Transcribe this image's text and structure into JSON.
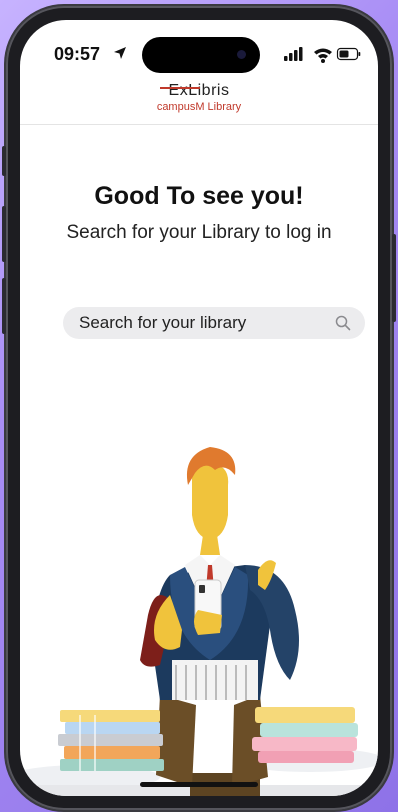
{
  "status_bar": {
    "time": "09:57",
    "icons": [
      "location-arrow-icon",
      "signal-icon",
      "wifi-icon",
      "battery-icon"
    ]
  },
  "brand": {
    "name_top": "ExLibris",
    "name_bottom": "campusM Library",
    "accent_color": "#c0392b"
  },
  "main": {
    "greeting": "Good To see you!",
    "subtitle": "Search for your Library to log in",
    "search": {
      "placeholder": "Search for your library",
      "icon": "search-icon"
    }
  },
  "illustration": {
    "subject": "student-holding-phone-with-books"
  },
  "colors": {
    "background": "#a98ef5",
    "search_fill": "#ececee"
  }
}
